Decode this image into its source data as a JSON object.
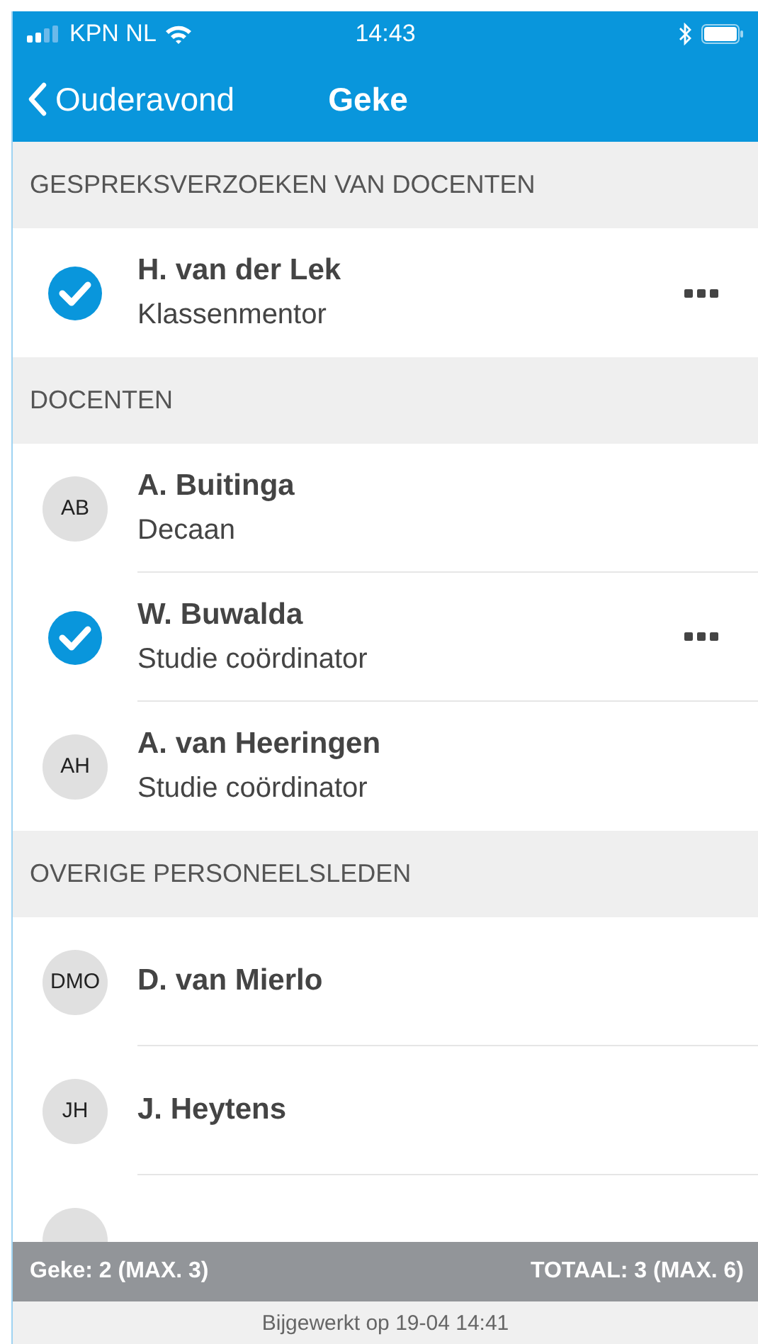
{
  "status_bar": {
    "carrier": "KPN NL",
    "time": "14:43"
  },
  "nav": {
    "back": "Ouderavond",
    "title": "Geke"
  },
  "sections": [
    {
      "title": "GESPREKSVERZOEKEN VAN DOCENTEN",
      "people": [
        {
          "name": "H. van der Lek",
          "role": "Klassenmentor",
          "checked": true
        }
      ]
    },
    {
      "title": "DOCENTEN",
      "people": [
        {
          "name": "A. Buitinga",
          "role": "Decaan",
          "checked": false,
          "initials": "AB"
        },
        {
          "name": "W. Buwalda",
          "role": "Studie coördinator",
          "checked": true
        },
        {
          "name": "A. van Heeringen",
          "role": "Studie coördinator",
          "checked": false,
          "initials": "AH"
        }
      ]
    },
    {
      "title": "OVERIGE PERSONEELSLEDEN",
      "people": [
        {
          "name": "D. van Mierlo",
          "checked": false,
          "initials": "DMO"
        },
        {
          "name": "J. Heytens",
          "checked": false,
          "initials": "JH"
        },
        {
          "checked": false
        }
      ]
    }
  ],
  "summary": {
    "left": "Geke: 2 (MAX. 3)",
    "right": "TOTAAL: 3 (MAX. 6)"
  },
  "updated": "Bijgewerkt op 19-04 14:41"
}
